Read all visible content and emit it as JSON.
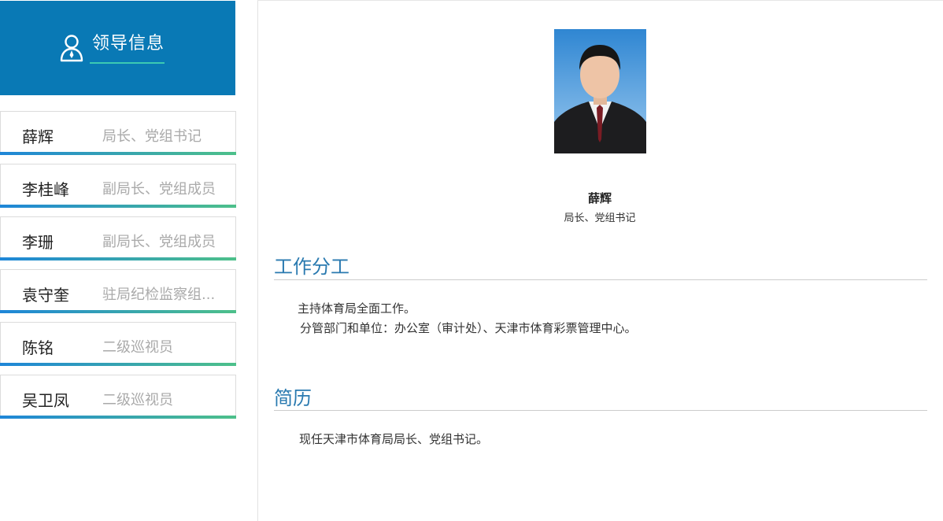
{
  "sidebar": {
    "header_title": "领导信息",
    "leaders": [
      {
        "name": "薛辉",
        "title": "局长、党组书记"
      },
      {
        "name": "李桂峰",
        "title": "副局长、党组成员"
      },
      {
        "name": "李珊",
        "title": "副局长、党组成员"
      },
      {
        "name": "袁守奎",
        "title": "驻局纪检监察组..."
      },
      {
        "name": "陈铭",
        "title": "二级巡视员"
      },
      {
        "name": "吴卫凤",
        "title": "二级巡视员"
      }
    ]
  },
  "profile": {
    "name": "薛辉",
    "title": "局长、党组书记"
  },
  "sections": {
    "duties": {
      "heading": "工作分工",
      "line1": "主持体育局全面工作。",
      "line2": "分管部门和单位：办公室（审计处）、天津市体育彩票管理中心。"
    },
    "resume": {
      "heading": "简历",
      "line1": "现任天津市体育局局长、党组书记。"
    }
  },
  "colors": {
    "header_bg": "#0979b5",
    "accent_teal": "#3cc9b2",
    "gradient_start": "#1e86d8",
    "gradient_end": "#4dc08a",
    "section_title": "#2a7ab0"
  }
}
